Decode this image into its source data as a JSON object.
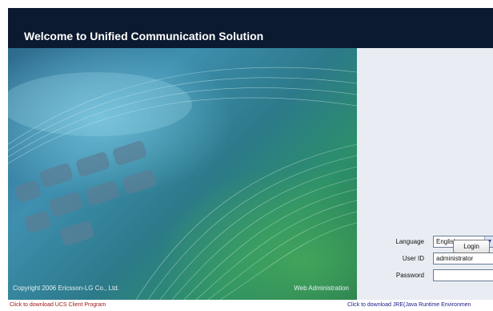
{
  "header": {
    "title": "Welcome to Unified Communication Solution"
  },
  "hero": {
    "copyright": "Copyright 2006 Ericsson-LG Co., Ltd.",
    "web_admin": "Web Administration"
  },
  "login": {
    "language_label": "Language",
    "language_value": "English",
    "userid_label": "User ID",
    "userid_value": "administrator",
    "password_label": "Password",
    "password_value": "",
    "login_button": "Login"
  },
  "footer": {
    "ucs_client_link": "Click to download UCS Client Program",
    "jre_link": "Click to download JRE(Java Runtime Environmen"
  },
  "colors": {
    "header_bg": "#0c1a30",
    "panel_bg": "#e9edf3",
    "link_red": "#a01818",
    "link_dark": "#1a1a8a"
  }
}
